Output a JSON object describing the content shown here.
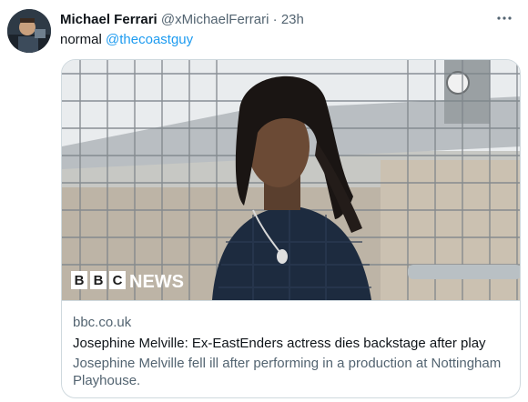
{
  "tweet": {
    "author_name": "Michael Ferrari",
    "author_handle": "@xMichaelFerrari",
    "separator": "·",
    "time": "23h",
    "text_prefix": "normal",
    "mention": "@thecoastguy"
  },
  "card": {
    "brand_logo_letters": [
      "B",
      "B",
      "C"
    ],
    "brand_logo_word": "NEWS",
    "domain": "bbc.co.uk",
    "title": "Josephine Melville: Ex-EastEnders actress dies backstage after play",
    "description": "Josephine Melville fell ill after performing in a production at Nottingham Playhouse."
  },
  "icons": {
    "more": "more-horizontal-icon",
    "avatar": "avatar"
  },
  "colors": {
    "link": "#1d9bf0",
    "secondary_text": "#536471",
    "border": "#cfd9de"
  }
}
